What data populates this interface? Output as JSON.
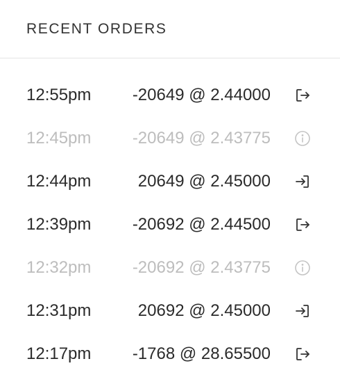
{
  "header": {
    "title": "RECENT ORDERS"
  },
  "orders": [
    {
      "time": "12:55pm",
      "detail": "-20649 @ 2.44000",
      "status": "active",
      "icon": "exit-icon"
    },
    {
      "time": "12:45pm",
      "detail": "-20649 @ 2.43775",
      "status": "cancelled",
      "icon": "info-icon"
    },
    {
      "time": "12:44pm",
      "detail": "20649 @ 2.45000",
      "status": "active",
      "icon": "enter-icon"
    },
    {
      "time": "12:39pm",
      "detail": "-20692 @ 2.44500",
      "status": "active",
      "icon": "exit-icon"
    },
    {
      "time": "12:32pm",
      "detail": "-20692 @ 2.43775",
      "status": "cancelled",
      "icon": "info-icon"
    },
    {
      "time": "12:31pm",
      "detail": "20692 @ 2.45000",
      "status": "active",
      "icon": "enter-icon"
    },
    {
      "time": "12:17pm",
      "detail": "-1768 @ 28.65500",
      "status": "active",
      "icon": "exit-icon"
    }
  ],
  "colors": {
    "active_text": "#2b2b2b",
    "cancelled_text": "#bdbdbd",
    "divider": "#e3e3e3"
  }
}
